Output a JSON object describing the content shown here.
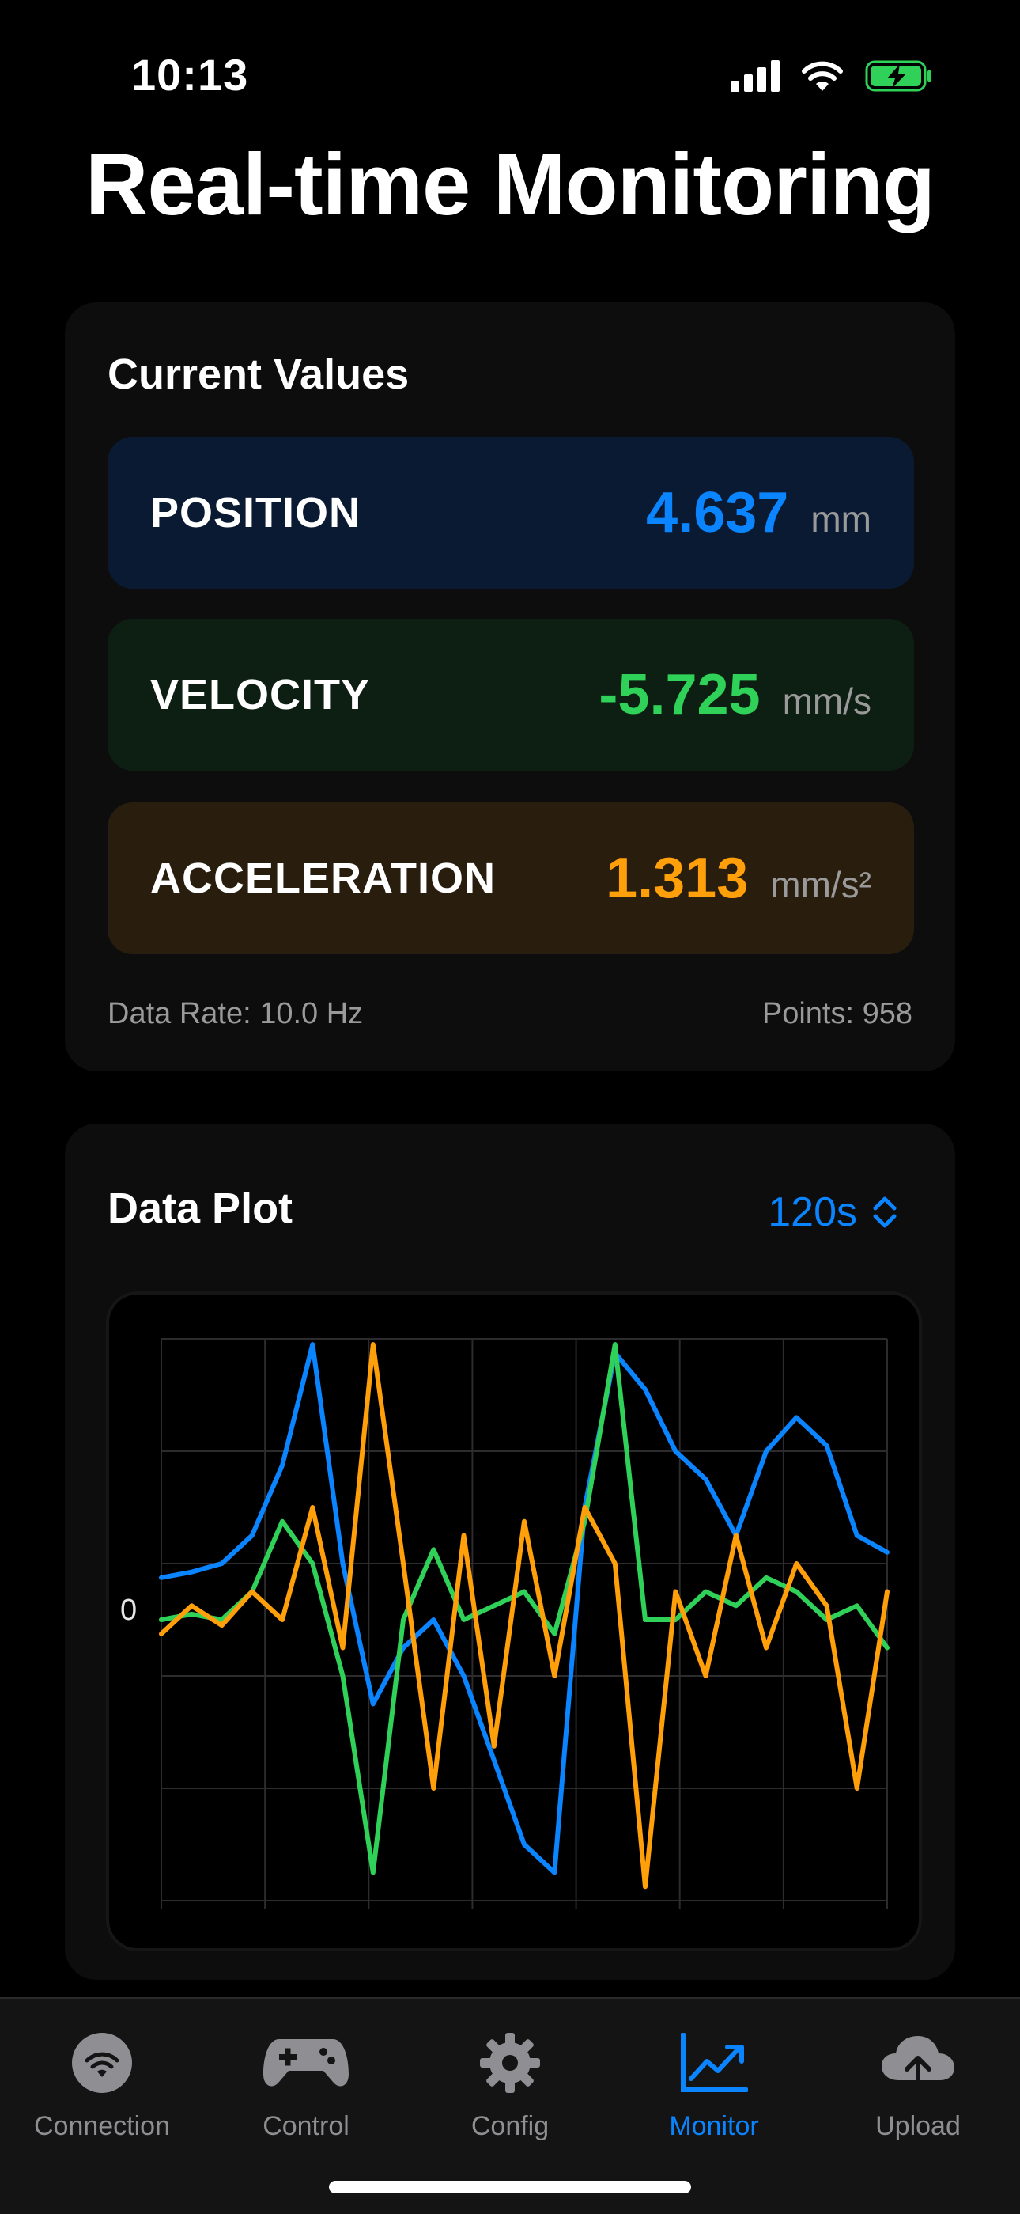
{
  "status": {
    "time": "10:13"
  },
  "title": "Real-time Monitoring",
  "current": {
    "heading": "Current Values",
    "rows": [
      {
        "label": "POSITION",
        "value": "4.637",
        "unit": "mm",
        "color": "#0a84ff",
        "bg": "#0b1a33"
      },
      {
        "label": "VELOCITY",
        "value": "-5.725",
        "unit": "mm/s",
        "color": "#30d158",
        "bg": "#0d1f12"
      },
      {
        "label": "ACCELERATION",
        "value": "1.313",
        "unit": "mm/s²",
        "color": "#ff9f0a",
        "bg": "#291e0e"
      }
    ],
    "data_rate": "Data Rate: 10.0 Hz",
    "points": "Points: 958"
  },
  "plot": {
    "heading": "Data Plot",
    "range_label": "120s",
    "zero_label": "0"
  },
  "chart_data": {
    "type": "line",
    "title": "",
    "xlabel": "",
    "ylabel": "",
    "x": [
      0,
      5,
      10,
      15,
      20,
      25,
      30,
      35,
      40,
      45,
      50,
      55,
      60,
      65,
      70,
      75,
      80,
      85,
      90,
      95,
      100,
      105,
      110,
      115,
      120
    ],
    "ylim": [
      -1,
      1
    ],
    "grid": true,
    "series": [
      {
        "values": [
          0.15,
          0.17,
          0.2,
          0.3,
          0.55,
          0.98,
          0.2,
          -0.3,
          -0.1,
          0.0,
          -0.2,
          -0.5,
          -0.8,
          -0.9,
          0.4,
          0.95,
          0.82,
          0.6,
          0.5,
          0.3,
          0.6,
          0.72,
          0.62,
          0.3,
          0.24
        ],
        "color": "#0a84ff"
      },
      {
        "values": [
          0.0,
          0.02,
          0.0,
          0.1,
          0.35,
          0.2,
          -0.2,
          -0.9,
          0.0,
          0.25,
          0.0,
          0.05,
          0.1,
          -0.05,
          0.35,
          0.98,
          0.0,
          0.0,
          0.1,
          0.05,
          0.15,
          0.1,
          0.0,
          0.05,
          -0.1
        ],
        "color": "#30d158"
      },
      {
        "values": [
          -0.05,
          0.05,
          -0.02,
          0.1,
          0.0,
          0.4,
          -0.1,
          0.98,
          0.2,
          -0.6,
          0.3,
          -0.45,
          0.35,
          -0.2,
          0.4,
          0.2,
          -0.95,
          0.1,
          -0.2,
          0.3,
          -0.1,
          0.2,
          0.05,
          -0.6,
          0.1
        ],
        "color": "#ff9f0a"
      }
    ]
  },
  "tabs": [
    {
      "label": "Connection",
      "icon": "wifi-circle-icon",
      "active": false
    },
    {
      "label": "Control",
      "icon": "gamepad-icon",
      "active": false
    },
    {
      "label": "Config",
      "icon": "gear-icon",
      "active": false
    },
    {
      "label": "Monitor",
      "icon": "chart-line-icon",
      "active": true
    },
    {
      "label": "Upload",
      "icon": "cloud-upload-icon",
      "active": false
    }
  ]
}
